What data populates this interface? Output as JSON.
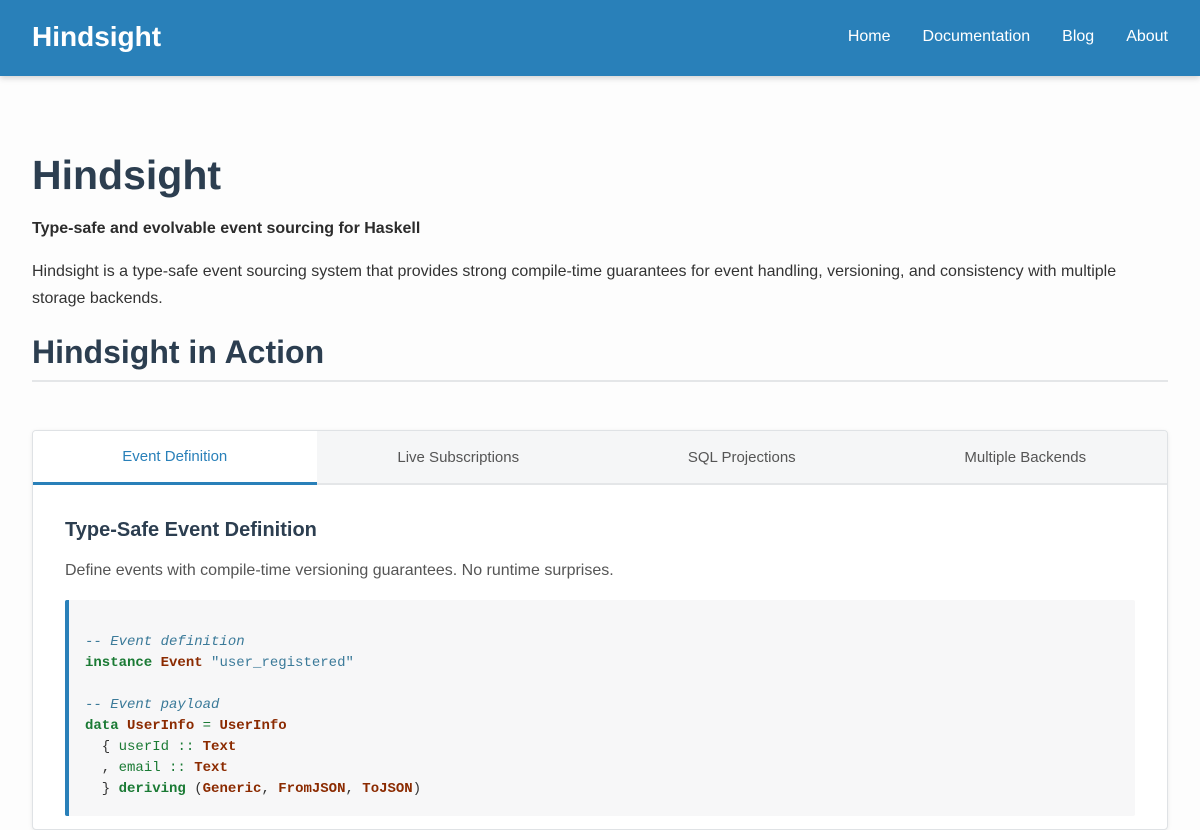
{
  "header": {
    "brand": "Hindsight",
    "nav": [
      "Home",
      "Documentation",
      "Blog",
      "About"
    ]
  },
  "hero": {
    "title": "Hindsight",
    "tagline": "Type-safe and evolvable event sourcing for Haskell",
    "description": "Hindsight is a type-safe event sourcing system that provides strong compile-time guarantees for event handling, versioning, and consistency with multiple storage backends."
  },
  "section": {
    "title": "Hindsight in Action"
  },
  "tabs": [
    {
      "label": "Event Definition",
      "active": true
    },
    {
      "label": "Live Subscriptions",
      "active": false
    },
    {
      "label": "SQL Projections",
      "active": false
    },
    {
      "label": "Multiple Backends",
      "active": false
    }
  ],
  "panel": {
    "title": "Type-Safe Event Definition",
    "description": "Define events with compile-time versioning guarantees. No runtime surprises.",
    "code": {
      "comment1": "-- Event definition",
      "kw_instance": "instance",
      "type_event": "Event",
      "event_name": "\"user_registered\"",
      "comment2": "-- Event payload",
      "kw_data": "data",
      "type_userinfo": "UserInfo",
      "op_eq": "=",
      "ctor_userinfo": "UserInfo",
      "field_userid": "userId",
      "op_dc1": "::",
      "type_text1": "Text",
      "field_email": "email",
      "op_dc2": "::",
      "type_text2": "Text",
      "kw_deriving": "deriving",
      "type_generic": "Generic",
      "type_fromjson": "FromJSON",
      "type_tojson": "ToJSON"
    }
  }
}
